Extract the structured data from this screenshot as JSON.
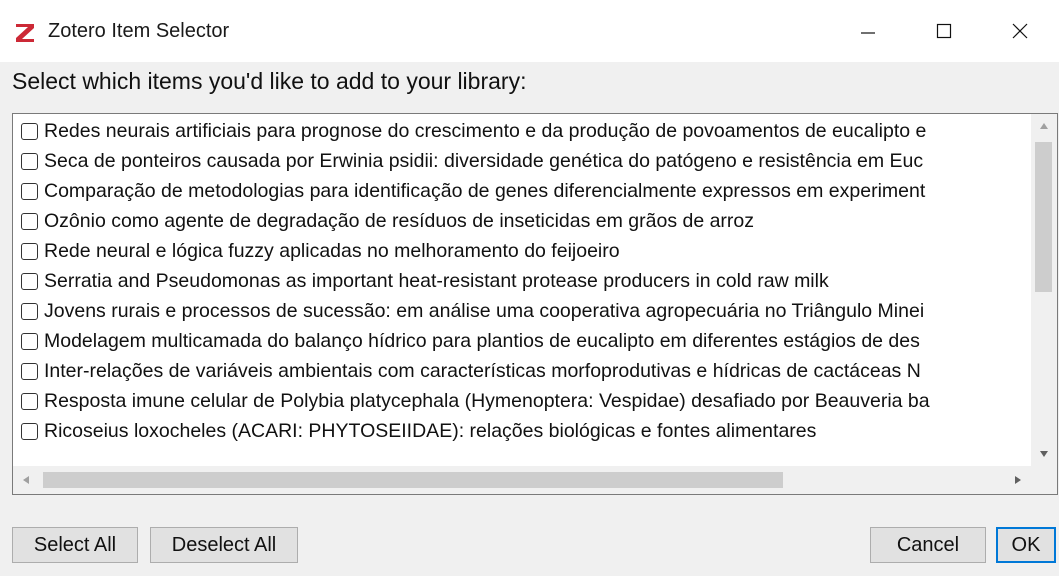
{
  "window": {
    "title": "Zotero Item Selector",
    "accent_color": "#cc2936"
  },
  "prompt": "Select which items you'd like to add to your library:",
  "items": [
    {
      "label": "Redes neurais artificiais para prognose do crescimento e da produção de povoamentos de eucalipto e",
      "checked": false
    },
    {
      "label": "Seca de ponteiros causada por Erwinia psidii: diversidade genética do patógeno e resistência em Euc",
      "checked": false
    },
    {
      "label": "Comparação de metodologias para identificação de genes diferencialmente expressos em experiment",
      "checked": false
    },
    {
      "label": "Ozônio como agente de degradação de resíduos de inseticidas em grãos de arroz",
      "checked": false
    },
    {
      "label": "Rede neural e lógica fuzzy aplicadas no melhoramento do feijoeiro",
      "checked": false
    },
    {
      "label": "Serratia and Pseudomonas as important heat-resistant protease producers in cold raw milk",
      "checked": false
    },
    {
      "label": "Jovens rurais e processos de sucessão: em análise uma cooperativa agropecuária no Triângulo Minei",
      "checked": false
    },
    {
      "label": "Modelagem multicamada do balanço hídrico para plantios de eucalipto em diferentes estágios de des",
      "checked": false
    },
    {
      "label": "Inter-relações de variáveis ambientais com características morfoprodutivas e hídricas de cactáceas N",
      "checked": false
    },
    {
      "label": "Resposta imune celular de Polybia platycephala (Hymenoptera: Vespidae) desafiado por Beauveria ba",
      "checked": false
    },
    {
      "label": "Ricoseius loxocheles (ACARI: PHYTOSEIIDAE): relações biológicas e fontes alimentares",
      "checked": false
    }
  ],
  "buttons": {
    "select_all": "Select All",
    "deselect_all": "Deselect All",
    "cancel": "Cancel",
    "ok": "OK"
  }
}
